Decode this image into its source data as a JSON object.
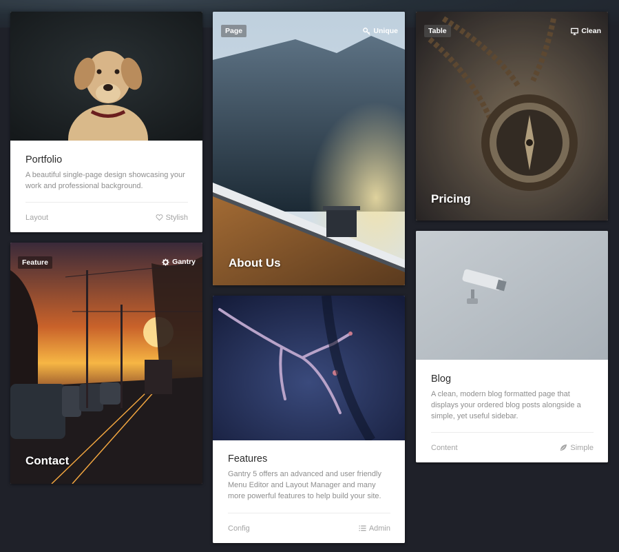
{
  "cards": {
    "portfolio": {
      "title": "Portfolio",
      "description": "A beautiful single-page design showcasing your work and professional background.",
      "meta_left": "Layout",
      "meta_right": "Stylish",
      "meta_icon": "heart-icon"
    },
    "about": {
      "tag": "Page",
      "badge": "Unique",
      "badge_icon": "key-icon",
      "title": "About Us"
    },
    "pricing": {
      "tag": "Table",
      "badge": "Clean",
      "badge_icon": "monitor-icon",
      "title": "Pricing"
    },
    "contact": {
      "tag": "Feature",
      "badge": "Gantry",
      "badge_icon": "gear-icon",
      "title": "Contact"
    },
    "features": {
      "title": "Features",
      "description": "Gantry 5 offers an advanced and user friendly Menu Editor and Layout Manager and many more powerful features to help build your site.",
      "meta_left": "Config",
      "meta_right": "Admin",
      "meta_icon": "list-icon"
    },
    "blog": {
      "title": "Blog",
      "description": "A clean, modern blog formatted page that displays your ordered blog posts alongside a simple, yet useful sidebar.",
      "meta_left": "Content",
      "meta_right": "Simple",
      "meta_icon": "leaf-icon"
    }
  }
}
